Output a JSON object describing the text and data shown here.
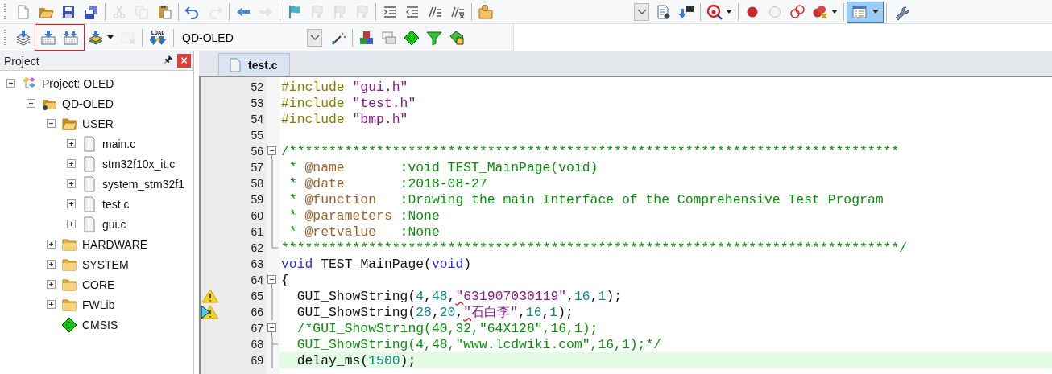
{
  "toolbar_top": {
    "buttons": [
      {
        "disabled": false
      },
      {
        "disabled": false
      },
      {
        "disabled": false
      },
      {
        "disabled": false
      },
      {
        "disabled": true
      },
      {
        "disabled": true
      },
      {
        "disabled": false
      },
      {
        "disabled": false
      },
      {
        "disabled": true
      },
      {
        "disabled": false
      },
      {
        "disabled": true
      },
      {
        "disabled": false
      },
      {
        "disabled": true
      },
      {
        "disabled": true
      },
      {
        "disabled": true
      },
      {
        "disabled": false
      },
      {
        "disabled": false
      },
      {
        "disabled": false
      },
      {
        "disabled": false
      },
      {
        "disabled": false
      },
      {
        "disabled": false
      },
      {
        "disabled": false
      },
      {
        "disabled": false
      },
      {
        "disabled": false
      },
      {
        "disabled": false
      },
      {
        "disabled": false
      },
      {
        "disabled": false
      },
      {
        "disabled": false
      },
      {
        "disabled": false
      }
    ],
    "view_toggle_selected": true
  },
  "toolbar_build": {
    "buttons": [
      {
        "disabled": false
      },
      {
        "disabled": false
      },
      {
        "disabled": false
      },
      {
        "disabled": false
      },
      {
        "disabled": true
      },
      {
        "disabled": false
      },
      {
        "disabled": false
      },
      {
        "disabled": false
      },
      {
        "disabled": false
      },
      {
        "disabled": false
      },
      {
        "disabled": false
      },
      {
        "disabled": false
      }
    ],
    "load_label": "LOAD",
    "target": "QD-OLED"
  },
  "project_panel": {
    "title": "Project",
    "pin": "🖈",
    "close": "×",
    "tree": [
      {
        "kind": "project",
        "label": "Project: OLED",
        "expanded": true,
        "children": [
          {
            "kind": "group",
            "label": "QD-OLED",
            "expanded": true,
            "children": [
              {
                "kind": "folder",
                "label": "USER",
                "expanded": true,
                "children": [
                  {
                    "kind": "file",
                    "label": "main.c",
                    "expanded": false
                  },
                  {
                    "kind": "file",
                    "label": "stm32f10x_it.c",
                    "expanded": false
                  },
                  {
                    "kind": "file",
                    "label": "system_stm32f1",
                    "expanded": false
                  },
                  {
                    "kind": "file",
                    "label": "test.c",
                    "expanded": false
                  },
                  {
                    "kind": "file",
                    "label": "gui.c",
                    "expanded": false
                  }
                ]
              },
              {
                "kind": "folder",
                "label": "HARDWARE",
                "expanded": false
              },
              {
                "kind": "folder",
                "label": "SYSTEM",
                "expanded": false
              },
              {
                "kind": "folder",
                "label": "CORE",
                "expanded": false
              },
              {
                "kind": "folder",
                "label": "FWLib",
                "expanded": false
              },
              {
                "kind": "component",
                "label": "CMSIS"
              }
            ]
          }
        ]
      }
    ]
  },
  "editor": {
    "tabs": [
      {
        "label": "test.c",
        "selected": true
      }
    ],
    "lines": [
      {
        "number": "52",
        "kind": "plain",
        "highlighted": false,
        "tokens": [
          {
            "kind": "pre",
            "text": "#include "
          },
          {
            "kind": "str",
            "text": "\"gui.h\""
          }
        ]
      },
      {
        "number": "53",
        "kind": "plain",
        "highlighted": false,
        "tokens": [
          {
            "kind": "pre",
            "text": "#include "
          },
          {
            "kind": "str",
            "text": "\"test.h\""
          }
        ]
      },
      {
        "number": "54",
        "kind": "plain",
        "highlighted": false,
        "tokens": [
          {
            "kind": "pre",
            "text": "#include "
          },
          {
            "kind": "str",
            "text": "\"bmp.h\""
          }
        ]
      },
      {
        "number": "55",
        "kind": "plain",
        "highlighted": false
      },
      {
        "number": "56",
        "kind": "fold-start",
        "expanded": true,
        "highlighted": false,
        "tokens": [
          {
            "kind": "comment",
            "text": "/*****************************************************************************"
          }
        ]
      },
      {
        "number": "57",
        "kind": "fold-body",
        "highlighted": false,
        "tokens": [
          {
            "kind": "comment",
            "text": " * "
          },
          {
            "kind": "tag",
            "text": "@name"
          },
          {
            "kind": "comment",
            "text": "       :void TEST_MainPage(void)"
          }
        ]
      },
      {
        "number": "58",
        "kind": "fold-body",
        "highlighted": false,
        "tokens": [
          {
            "kind": "comment",
            "text": " * "
          },
          {
            "kind": "tag",
            "text": "@date"
          },
          {
            "kind": "comment",
            "text": "       :2018-08-27"
          }
        ]
      },
      {
        "number": "59",
        "kind": "fold-body",
        "highlighted": false,
        "tokens": [
          {
            "kind": "comment",
            "text": " * "
          },
          {
            "kind": "tag",
            "text": "@function"
          },
          {
            "kind": "comment",
            "text": "   :Drawing the main Interface of the Comprehensive Test Program"
          }
        ]
      },
      {
        "number": "60",
        "kind": "fold-body",
        "highlighted": false,
        "tokens": [
          {
            "kind": "comment",
            "text": " * "
          },
          {
            "kind": "tag",
            "text": "@parameters"
          },
          {
            "kind": "comment",
            "text": " :None"
          }
        ]
      },
      {
        "number": "61",
        "kind": "fold-body",
        "highlighted": false,
        "tokens": [
          {
            "kind": "comment",
            "text": " * "
          },
          {
            "kind": "tag",
            "text": "@retvalue"
          },
          {
            "kind": "comment",
            "text": "   :None"
          }
        ]
      },
      {
        "number": "62",
        "kind": "fold-end",
        "highlighted": false,
        "tokens": [
          {
            "kind": "comment",
            "text": "******************************************************************************/"
          }
        ]
      },
      {
        "number": "63",
        "kind": "plain",
        "highlighted": false,
        "tokens": [
          {
            "kind": "keyword",
            "text": "void"
          },
          {
            "kind": "plain",
            "text": " TEST_MainPage("
          },
          {
            "kind": "keyword",
            "text": "void"
          },
          {
            "kind": "plain",
            "text": ")"
          }
        ]
      },
      {
        "number": "64",
        "kind": "fold-start",
        "expanded": true,
        "highlighted": false,
        "tokens": [
          {
            "kind": "plain",
            "text": "{"
          }
        ]
      },
      {
        "number": "65",
        "kind": "fold-body",
        "warning": true,
        "current": false,
        "highlighted": false,
        "tokens": [
          {
            "kind": "plain",
            "text": "  GUI_ShowString("
          },
          {
            "kind": "num",
            "text": "4"
          },
          {
            "kind": "plain",
            "text": ","
          },
          {
            "kind": "num",
            "text": "48"
          },
          {
            "kind": "plain",
            "text": ","
          },
          {
            "kind": "warn",
            "text": "\""
          },
          {
            "kind": "str",
            "text": "631907030119\""
          },
          {
            "kind": "plain",
            "text": ","
          },
          {
            "kind": "num",
            "text": "16"
          },
          {
            "kind": "plain",
            "text": ","
          },
          {
            "kind": "num",
            "text": "1"
          },
          {
            "kind": "plain",
            "text": ");"
          }
        ]
      },
      {
        "number": "66",
        "kind": "fold-body",
        "warning": true,
        "current": true,
        "highlighted": false,
        "tokens": [
          {
            "kind": "plain",
            "text": "  GUI_ShowString("
          },
          {
            "kind": "num",
            "text": "28"
          },
          {
            "kind": "plain",
            "text": ","
          },
          {
            "kind": "num",
            "text": "20"
          },
          {
            "kind": "plain",
            "text": ","
          },
          {
            "kind": "warn",
            "text": "\""
          },
          {
            "kind": "str",
            "text": "石白李\""
          },
          {
            "kind": "plain",
            "text": ","
          },
          {
            "kind": "num",
            "text": "16"
          },
          {
            "kind": "plain",
            "text": ","
          },
          {
            "kind": "num",
            "text": "1"
          },
          {
            "kind": "plain",
            "text": ");"
          }
        ]
      },
      {
        "number": "67",
        "kind": "fold-start",
        "expanded": true,
        "highlighted": false,
        "tokens": [
          {
            "kind": "comment",
            "text": "  /*GUI_ShowString(40,32,\"64X128\",16,1);"
          }
        ]
      },
      {
        "number": "68",
        "kind": "fold-branch",
        "highlighted": false,
        "tokens": [
          {
            "kind": "comment",
            "text": "  GUI_ShowString(4,48,\"www.lcdwiki.com\",16,1);*/"
          }
        ]
      },
      {
        "number": "69",
        "kind": "fold-body",
        "highlighted": true,
        "tokens": [
          {
            "kind": "plain",
            "text": "  delay_ms("
          },
          {
            "kind": "num",
            "text": "1500"
          },
          {
            "kind": "plain",
            "text": ");"
          }
        ]
      }
    ]
  }
}
